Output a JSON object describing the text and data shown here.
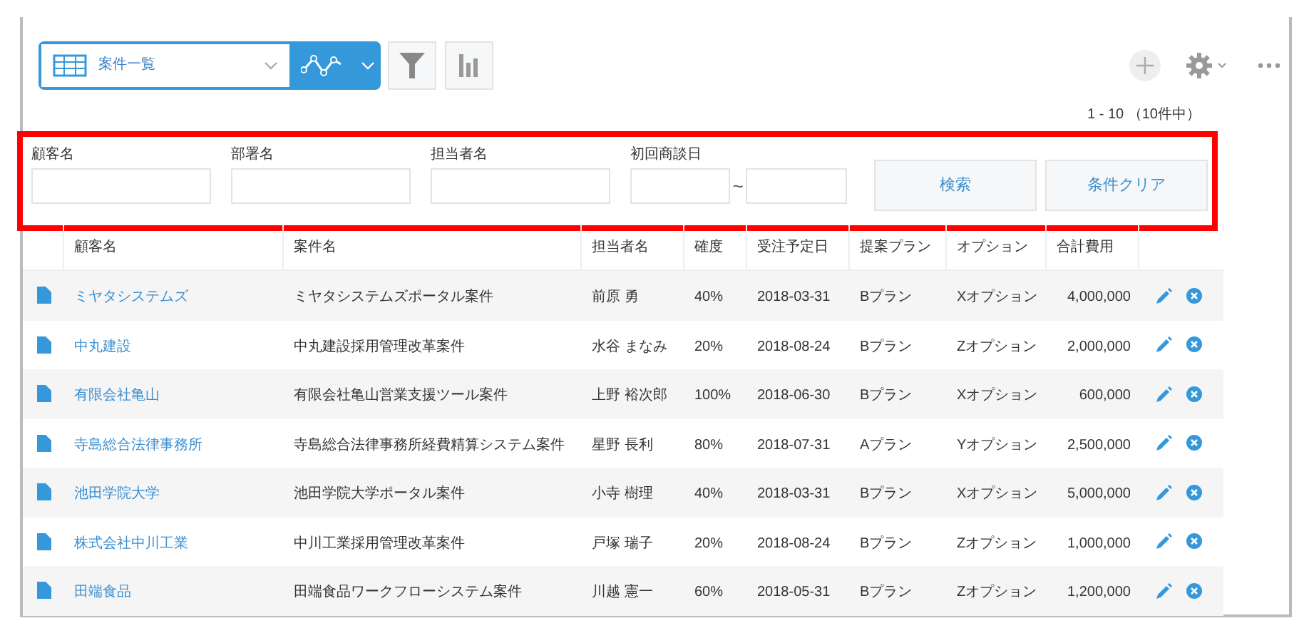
{
  "toolbar": {
    "view_select": {
      "value": "案件一覧"
    }
  },
  "pagination": "1 - 10 （10件中）",
  "search": {
    "fields": [
      {
        "label": "顧客名",
        "kind": "text"
      },
      {
        "label": "部署名",
        "kind": "text"
      },
      {
        "label": "担当者名",
        "kind": "text"
      },
      {
        "label": "初回商談日",
        "kind": "range",
        "separator": "~"
      }
    ],
    "buttons": [
      "検索",
      "条件クリア"
    ]
  },
  "table": {
    "columns": [
      "顧客名",
      "案件名",
      "担当者名",
      "確度",
      "受注予定日",
      "提案プラン",
      "オプション",
      "合計費用"
    ],
    "rows": [
      {
        "cells": [
          "ミヤタシステムズ",
          "ミヤタシステムズポータル案件",
          "前原 勇",
          "40%",
          "2018-03-31",
          "Bプラン",
          "Xオプション",
          "4,000,000"
        ]
      },
      {
        "cells": [
          "中丸建設",
          "中丸建設採用管理改革案件",
          "水谷 まなみ",
          "20%",
          "2018-08-24",
          "Bプラン",
          "Zオプション",
          "2,000,000"
        ]
      },
      {
        "cells": [
          "有限会社亀山",
          "有限会社亀山営業支援ツール案件",
          "上野 裕次郎",
          "100%",
          "2018-06-30",
          "Bプラン",
          "Xオプション",
          "600,000"
        ]
      },
      {
        "cells": [
          "寺島総合法律事務所",
          "寺島総合法律事務所経費精算システム案件",
          "星野 長利",
          "80%",
          "2018-07-31",
          "Aプラン",
          "Yオプション",
          "2,500,000"
        ]
      },
      {
        "cells": [
          "池田学院大学",
          "池田学院大学ポータル案件",
          "小寺 樹理",
          "40%",
          "2018-03-31",
          "Bプラン",
          "Xオプション",
          "5,000,000"
        ]
      },
      {
        "cells": [
          "株式会社中川工業",
          "中川工業採用管理改革案件",
          "戸塚 瑞子",
          "20%",
          "2018-08-24",
          "Bプラン",
          "Zオプション",
          "1,000,000"
        ]
      },
      {
        "cells": [
          "田端食品",
          "田端食品ワークフローシステム案件",
          "川越 憲一",
          "60%",
          "2018-05-31",
          "Bプラン",
          "Zオプション",
          "1,200,000"
        ]
      }
    ]
  }
}
